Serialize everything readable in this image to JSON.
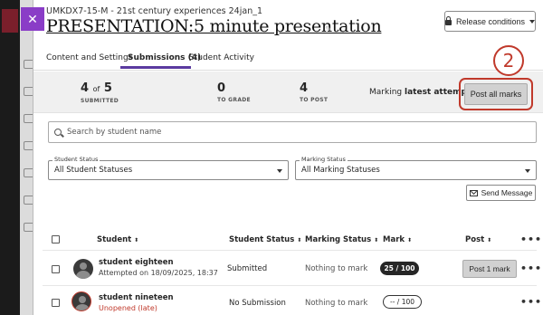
{
  "header": {
    "course": "UMKDX7-15-M - 21st century experiences 24jan_1",
    "title": "PRESENTATION:5 minute presentation",
    "release_conditions": "Release conditions"
  },
  "close_glyph": "✕",
  "tabs": [
    {
      "label": "Content and Settings"
    },
    {
      "label": "Submissions (4)"
    },
    {
      "label": "Student Activity"
    }
  ],
  "summary": {
    "submitted_count": "4",
    "submitted_of": "of",
    "submitted_total": "5",
    "submitted_label": "SUBMITTED",
    "to_grade": "0",
    "to_grade_label": "TO GRADE",
    "to_post": "4",
    "to_post_label": "TO POST",
    "marking_prefix": "Marking",
    "marking_value": "latest attempt",
    "post_all": "Post all marks"
  },
  "callout_number": "2",
  "search": {
    "placeholder": "Search by student name"
  },
  "filters": {
    "student_status_label": "Student Status",
    "student_status_value": "All Student Statuses",
    "marking_status_label": "Marking Status",
    "marking_status_value": "All Marking Statuses"
  },
  "send_message": "Send Message",
  "columns": {
    "student": "Student",
    "student_status": "Student Status",
    "marking_status": "Marking Status",
    "mark": "Mark",
    "post": "Post",
    "sort_glyph": "⬍",
    "more": "•••"
  },
  "rows": [
    {
      "name": "student eighteen",
      "sub": "Attempted on 18/09/2025, 18:37",
      "status": "Submitted",
      "marking": "Nothing to mark",
      "mark": "25 / 100",
      "post": "Post 1 mark"
    },
    {
      "name": "student nineteen",
      "sub": "Unopened (late)",
      "status": "No Submission",
      "marking": "Nothing to mark",
      "mark": "-- / 100",
      "post": ""
    }
  ],
  "colors": {
    "accent": "#5b3ba0",
    "close_button": "#8a3dc7",
    "callout": "#c0392b"
  }
}
